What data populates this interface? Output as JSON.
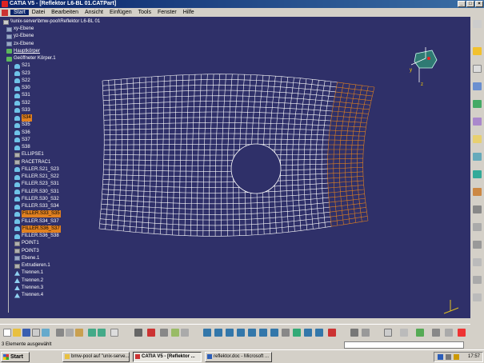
{
  "window": {
    "title": "CATIA V5 - [Reflektor L6-BL 01.CATPart]"
  },
  "menu": [
    "Start",
    "Datei",
    "Bearbeiten",
    "Ansicht",
    "Einfügen",
    "Tools",
    "Fenster",
    "Hilfe"
  ],
  "tree": {
    "root": "\\\\unix-server\\bmw-pool\\Reflektor L6-BL 01",
    "items": [
      {
        "label": "xy-Ebene",
        "icon": "plane-icon"
      },
      {
        "label": "yz-Ebene",
        "icon": "plane-icon"
      },
      {
        "label": "zx-Ebene",
        "icon": "plane-icon"
      },
      {
        "label": "Hauptkörper",
        "icon": "body-icon"
      },
      {
        "label": "Geöffneter Körper.1",
        "icon": "body-icon"
      },
      {
        "label": "S21",
        "icon": "surface-icon"
      },
      {
        "label": "S23",
        "icon": "surface-icon"
      },
      {
        "label": "S22",
        "icon": "surface-icon"
      },
      {
        "label": "S30",
        "icon": "surface-icon"
      },
      {
        "label": "S31",
        "icon": "surface-icon"
      },
      {
        "label": "S32",
        "icon": "surface-icon"
      },
      {
        "label": "S33",
        "icon": "surface-icon"
      },
      {
        "label": "S34",
        "icon": "surface-icon"
      },
      {
        "label": "S35",
        "icon": "surface-icon"
      },
      {
        "label": "S36",
        "icon": "surface-icon"
      },
      {
        "label": "S37",
        "icon": "surface-icon"
      },
      {
        "label": "S38",
        "icon": "surface-icon"
      },
      {
        "label": "ELLIPSE1",
        "icon": "sketch-icon"
      },
      {
        "label": "RACETRAC1",
        "icon": "sketch-icon"
      },
      {
        "label": "FILLER.S21_S23",
        "icon": "surface-icon"
      },
      {
        "label": "FILLER.S21_S22",
        "icon": "surface-icon"
      },
      {
        "label": "FILLER.S23_S31",
        "icon": "surface-icon"
      },
      {
        "label": "FILLER.S30_S31",
        "icon": "surface-icon"
      },
      {
        "label": "FILLER.S30_S32",
        "icon": "surface-icon"
      },
      {
        "label": "FILLER.S33_S34",
        "icon": "surface-icon"
      },
      {
        "label": "FILLER.S33_S35",
        "icon": "surface-icon"
      },
      {
        "label": "FILLER.S34_S37",
        "icon": "surface-icon"
      },
      {
        "label": "FILLER.S36_S37",
        "icon": "surface-icon"
      },
      {
        "label": "FILLER.S36_S38",
        "icon": "surface-icon"
      },
      {
        "label": "POINT1",
        "icon": "sketch-icon"
      },
      {
        "label": "POINT3",
        "icon": "sketch-icon"
      },
      {
        "label": "Ebene.1",
        "icon": "plane-icon"
      },
      {
        "label": "Extrudieren.1",
        "icon": "sketch-icon"
      },
      {
        "label": "Trennen.1",
        "icon": "trim-icon"
      },
      {
        "label": "Trennen.2",
        "icon": "trim-icon"
      },
      {
        "label": "Trennen.3",
        "icon": "trim-icon"
      },
      {
        "label": "Trennen.4",
        "icon": "trim-icon"
      }
    ]
  },
  "status": {
    "message": "3 Elemente ausgewählt"
  },
  "taskbar": {
    "start": "Start",
    "tasks": [
      "bmw-pool auf \"unix-serve...",
      "CATIA V5 - [Reflektor ...",
      "reflektor.doc - Microsoft ..."
    ],
    "clock": "17:57"
  },
  "colors": {
    "viewport": "#2f3069",
    "selection": "#e08020",
    "mesh": "#ffffff",
    "titlebar": "#0a246a"
  }
}
